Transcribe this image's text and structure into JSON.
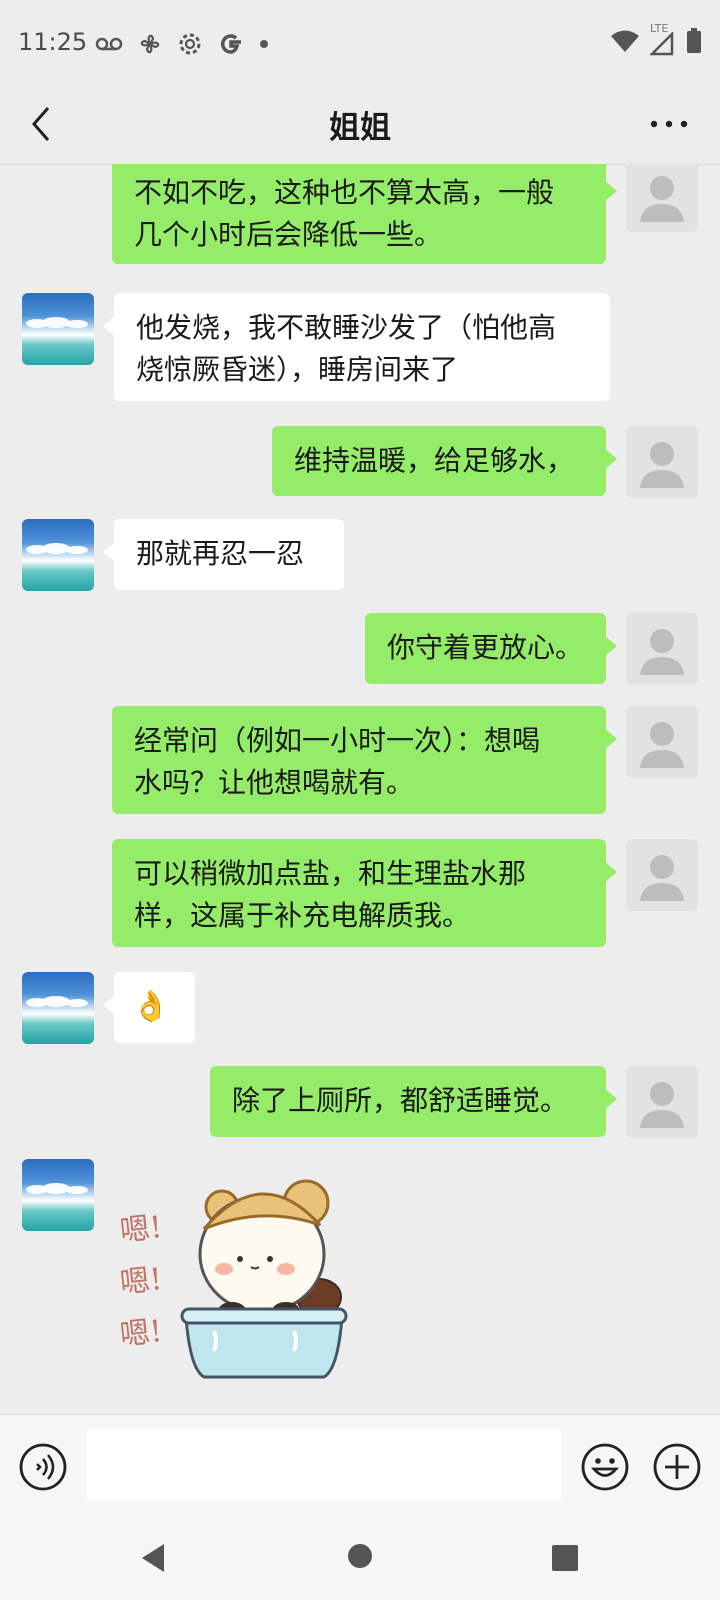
{
  "status_bar": {
    "time": "11:25",
    "network_label": "LTE",
    "left_icons": [
      "voicemail-icon",
      "fan-icon",
      "settings-icon",
      "google-icon",
      "dot-icon"
    ],
    "right_icons": [
      "wifi-icon",
      "signal-icon",
      "battery-icon"
    ]
  },
  "header": {
    "title": "姐姐",
    "back_icon": "chevron-left-icon",
    "more_icon": "more-dots-icon"
  },
  "messages": [
    {
      "sender": "me",
      "lines": [
        "不如不吃，这种也不算太高，一般",
        "几个小时后会降低一些。"
      ]
    },
    {
      "sender": "them",
      "lines": [
        "他发烧，我不敢睡沙发了（怕他高",
        "烧惊厥昏迷），睡房间来了"
      ]
    },
    {
      "sender": "me",
      "lines": [
        "维持温暖，给足够水，"
      ]
    },
    {
      "sender": "them",
      "lines": [
        "那就再忍一忍"
      ]
    },
    {
      "sender": "me",
      "lines": [
        "你守着更放心。"
      ]
    },
    {
      "sender": "me",
      "lines": [
        "经常问（例如一小时一次）：想喝",
        "水吗？让他想喝就有。"
      ]
    },
    {
      "sender": "me",
      "lines": [
        "可以稍微加点盐，和生理盐水那",
        "样，这属于补充电解质我。"
      ]
    },
    {
      "sender": "them",
      "emoji": "👌"
    },
    {
      "sender": "me",
      "lines": [
        "除了上厕所，都舒适睡觉。"
      ]
    },
    {
      "sender": "them",
      "sticker": {
        "text": [
          "嗯!",
          "嗯!",
          "嗯!"
        ]
      }
    }
  ],
  "input_bar": {
    "voice_icon": "voice-icon",
    "placeholder": "",
    "emoji_icon": "emoji-icon",
    "plus_icon": "plus-icon"
  },
  "system_nav": [
    "nav-back-icon",
    "nav-home-icon",
    "nav-recents-icon"
  ],
  "colors": {
    "my_bubble": "#95ec69",
    "their_bubble": "#ffffff",
    "background": "#ededed"
  }
}
